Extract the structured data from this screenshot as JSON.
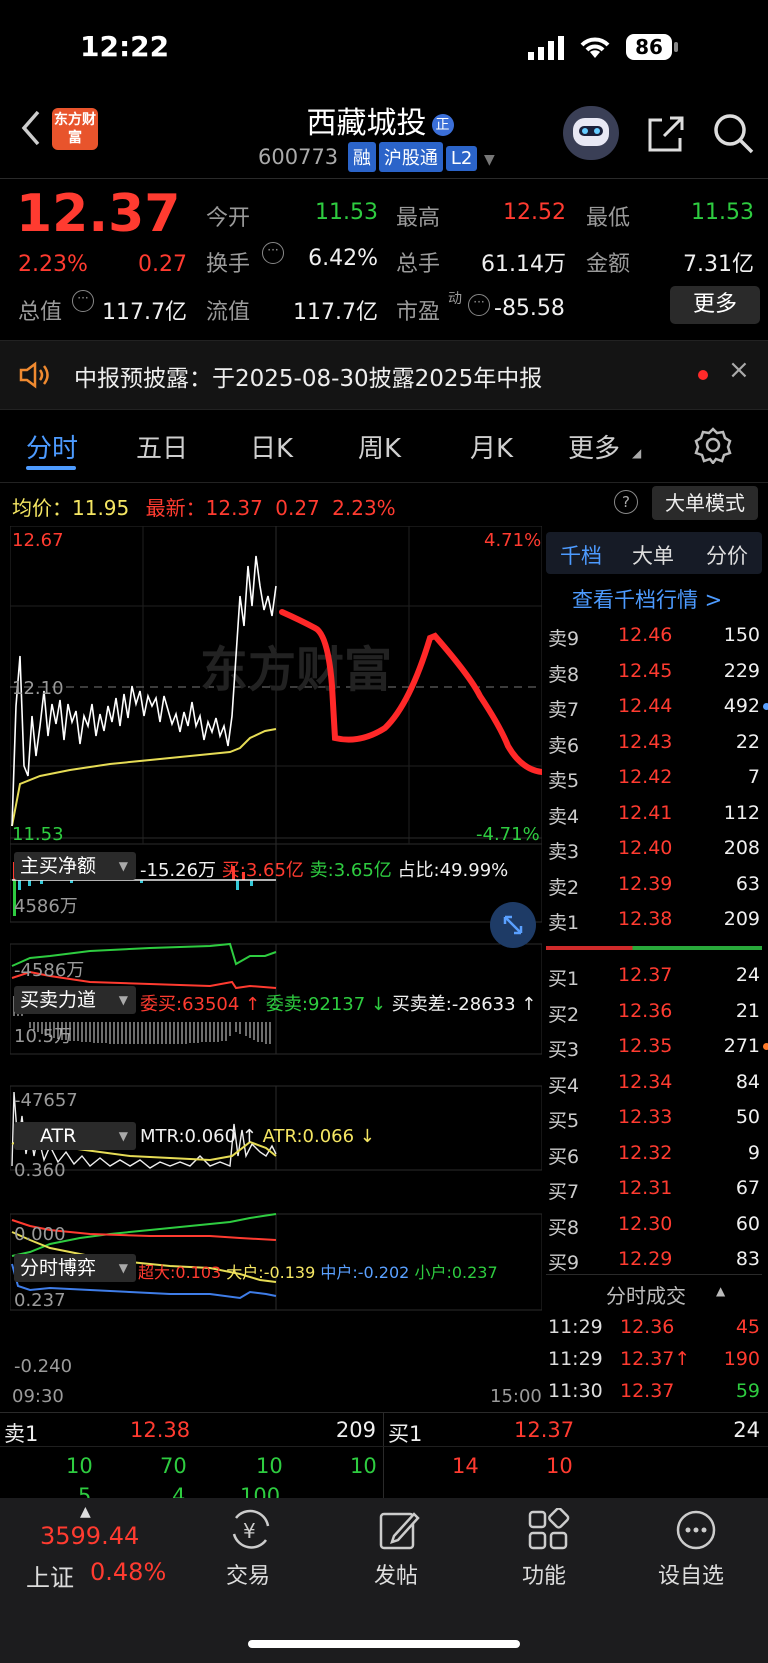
{
  "status_bar": {
    "time": "12:22",
    "battery": "86"
  },
  "header": {
    "logo_text": "东方财富",
    "stock_name": "西藏城投",
    "stock_badge": "正",
    "code": "600773",
    "tags": [
      "融",
      "沪股通",
      "L2"
    ]
  },
  "quote": {
    "price": "12.37",
    "change_pct": "2.23%",
    "change": "0.27",
    "rows": [
      [
        {
          "label": "今开",
          "value": "11.53",
          "color": "green"
        },
        {
          "label": "最高",
          "value": "12.52",
          "color": "red"
        },
        {
          "label": "最低",
          "value": "11.53",
          "color": "green"
        }
      ],
      [
        {
          "label": "换手",
          "value": "6.42%",
          "color": "white"
        },
        {
          "label": "总手",
          "value": "61.14万",
          "color": "white"
        },
        {
          "label": "金额",
          "value": "7.31亿",
          "color": "white"
        }
      ]
    ],
    "total_value_label": "总值",
    "total_value": "117.7亿",
    "float_label": "流值",
    "float_value": "117.7亿",
    "pe_label": "市盈",
    "pe_sup": "动",
    "pe_value": "-85.58",
    "more_button": "更多"
  },
  "notice": {
    "text": "中报预披露：于2025-08-30披露2025年中报"
  },
  "tabs": [
    "分时",
    "五日",
    "日K",
    "周K",
    "月K",
    "更多"
  ],
  "chart_header": {
    "avg_label": "均价：",
    "avg_value": "11.95",
    "latest_label": "最新：",
    "latest_value": "12.37",
    "change": "0.27",
    "change_pct": "2.23%",
    "mode_button": "大单模式"
  },
  "chart_data": {
    "type": "line",
    "y_high": "12.67",
    "y_mid": "12.10",
    "y_low": "11.53",
    "pct_high": "4.71%",
    "pct_low": "-4.71%",
    "x_start": "09:30",
    "x_end": "15:00",
    "watermark": "东方财富"
  },
  "indicators": {
    "main_net": {
      "label": "主买净额",
      "value": "-15.26万",
      "buy": "买:3.65亿",
      "sell": "卖:3.65亿",
      "ratio": "占比:49.99%",
      "top": "4586万",
      "bottom": "-4586万"
    },
    "force": {
      "label": "买卖力道",
      "buy": "委买:63504 ↑",
      "sell": "委卖:92137 ↓",
      "diff": "买卖差:-28633 ↑",
      "top": "10.5万",
      "bottom": "-47657"
    },
    "atr": {
      "label": "ATR",
      "mtr": "MTR:0.060 ↑",
      "atr": "ATR:0.066 ↓",
      "top": "0.360",
      "bottom": "0.000"
    },
    "game": {
      "label": "分时博弈",
      "super": "超大:0.103",
      "big": "大户:-0.139",
      "mid": "中户:-0.202",
      "small": "小户:0.237",
      "top": "0.237",
      "bottom": "-0.240"
    }
  },
  "order_book": {
    "tabs": [
      "千档",
      "大单",
      "分价"
    ],
    "view_link": "查看千档行情 >",
    "sells": [
      {
        "label": "卖9",
        "price": "12.46",
        "vol": "150"
      },
      {
        "label": "卖8",
        "price": "12.45",
        "vol": "229"
      },
      {
        "label": "卖7",
        "price": "12.44",
        "vol": "492"
      },
      {
        "label": "卖6",
        "price": "12.43",
        "vol": "22"
      },
      {
        "label": "卖5",
        "price": "12.42",
        "vol": "7"
      },
      {
        "label": "卖4",
        "price": "12.41",
        "vol": "112"
      },
      {
        "label": "卖3",
        "price": "12.40",
        "vol": "208"
      },
      {
        "label": "卖2",
        "price": "12.39",
        "vol": "63"
      },
      {
        "label": "卖1",
        "price": "12.38",
        "vol": "209"
      }
    ],
    "buys": [
      {
        "label": "买1",
        "price": "12.37",
        "vol": "24"
      },
      {
        "label": "买2",
        "price": "12.36",
        "vol": "21"
      },
      {
        "label": "买3",
        "price": "12.35",
        "vol": "271"
      },
      {
        "label": "买4",
        "price": "12.34",
        "vol": "84"
      },
      {
        "label": "买5",
        "price": "12.33",
        "vol": "50"
      },
      {
        "label": "买6",
        "price": "12.32",
        "vol": "9"
      },
      {
        "label": "买7",
        "price": "12.31",
        "vol": "67"
      },
      {
        "label": "买8",
        "price": "12.30",
        "vol": "60"
      },
      {
        "label": "买9",
        "price": "12.29",
        "vol": "83"
      }
    ],
    "trades_title": "分时成交",
    "trades": [
      {
        "time": "11:29",
        "price": "12.36",
        "vol": "45",
        "color": "red"
      },
      {
        "time": "11:29",
        "price": "12.37↑",
        "vol": "190",
        "color": "red"
      },
      {
        "time": "11:30",
        "price": "12.37",
        "vol": "59",
        "color": "green"
      }
    ]
  },
  "bottom_book": {
    "sell_label": "卖1",
    "sell_price": "12.38",
    "sell_vol": "209",
    "buy_label": "买1",
    "buy_price": "12.37",
    "buy_vol": "24",
    "sell_queue": [
      "10",
      "70",
      "10",
      "10"
    ],
    "sell_queue2": [
      "5",
      "4",
      "100"
    ],
    "buy_queue": [
      "14",
      "10"
    ]
  },
  "bottom_nav": {
    "index_value": "3599.44",
    "index_name": "上证",
    "index_pct": "0.48%",
    "items": [
      "交易",
      "发帖",
      "功能",
      "设自选"
    ]
  }
}
